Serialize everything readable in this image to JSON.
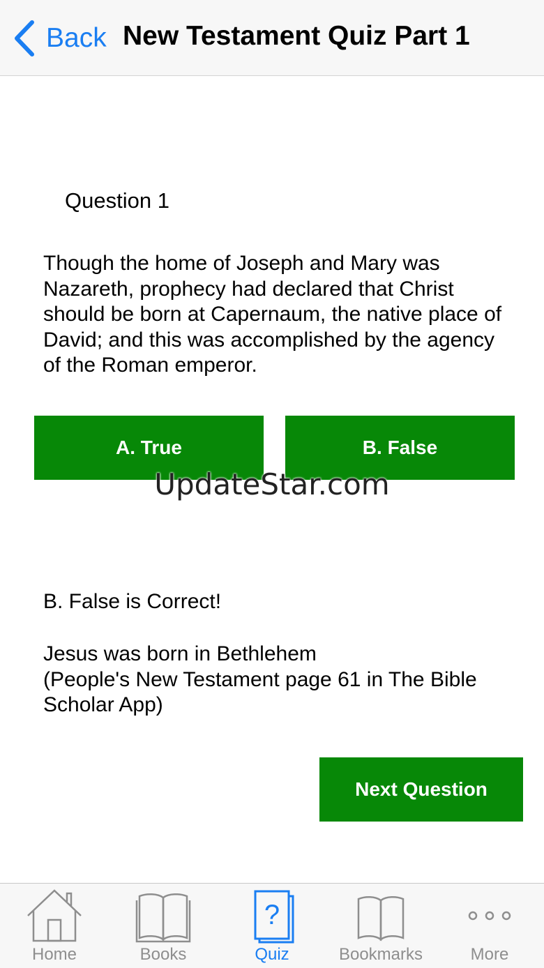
{
  "navbar": {
    "back_label": "Back",
    "title": "New Testament Quiz Part 1",
    "back_icon": "chevron-left-icon"
  },
  "question": {
    "number_label": "Question 1",
    "text": "Though the home of Joseph and Mary was Nazareth, prophecy had declared that Christ should be born at Capernaum, the native place of David; and this was accomplished by the agency of the Roman emperor."
  },
  "answers": {
    "a_label": "A. True",
    "b_label": "B. False"
  },
  "watermark": "UpdateStar.com",
  "feedback": {
    "result": "B. False is Correct!",
    "explanation_line1": "Jesus was born in Bethlehem",
    "explanation_line2": "(People's New Testament page 61 in The Bible Scholar App)"
  },
  "next_label": "Next Question",
  "tabbar": {
    "active": "Quiz",
    "items": [
      {
        "label": "Home",
        "icon": "home-icon"
      },
      {
        "label": "Books",
        "icon": "book-icon"
      },
      {
        "label": "Quiz",
        "icon": "quiz-icon"
      },
      {
        "label": "Bookmarks",
        "icon": "bookmark-icon"
      },
      {
        "label": "More",
        "icon": "more-icon"
      }
    ]
  },
  "colors": {
    "accent": "#1a7ef2",
    "button_green": "#078807",
    "tab_inactive": "#8e8e8e"
  }
}
